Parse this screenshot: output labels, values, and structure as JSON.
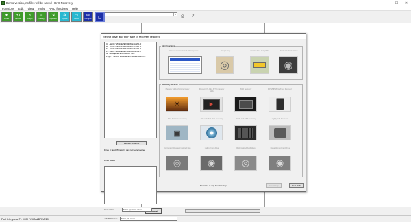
{
  "window": {
    "title": "Demo version, no files will be saved - DriK Recovery",
    "controls": {
      "minimize": "–",
      "maximize": "☐",
      "close": "✕"
    }
  },
  "menu": [
    "Functions",
    "Edit",
    "View",
    "Tools",
    "RAID functions",
    "Help"
  ],
  "toolbar": {
    "buttons": [
      {
        "label": "Wizard",
        "color": "#3f9b2a"
      },
      {
        "label": "Recover",
        "color": "#3f9b2a"
      },
      {
        "label": "Analyze",
        "color": "#3f9b2a"
      },
      {
        "label": "Catalog",
        "color": "#3f9b2a"
      },
      {
        "label": "Unpacked",
        "color": "#3f9b2a"
      },
      {
        "label": "Options",
        "color": "#2ab8d0"
      },
      {
        "label": "Drives",
        "color": "#2ab8d0"
      },
      {
        "label": "Configure",
        "color": "#1c2fa8"
      },
      {
        "label": "",
        "color": "#1c2fa8"
      }
    ],
    "select_arrow": "▾",
    "icons": [
      "printer-icon",
      "help-pointer-icon"
    ]
  },
  "bottom": {
    "cancel_label": "Cancel"
  },
  "statusbar": {
    "help_text": "For Help, press F1",
    "device_path": "\\\\.\\PHYSICALDRIVE19"
  },
  "dialog": {
    "title": "Select drive and then type of recovery required",
    "drives": [
      "C: - WDC      WD10EZEX-08WN4A0/01.0",
      "D: - WDC      WD10EZEX-08WN4A0/01.0",
      "E: - WDC      WD10EZEX-08WN4A0/01.0",
      "F: - WDC      WD10EZEX-08WN4A0/01.0",
      "G: - Image file and backup files",
      "Phys 1 - WDC    WD10EZEX-08WN4A0/01.0"
    ],
    "refresh_label": "Refresh drive list",
    "warning": "Drive C: and Physical 0 can not be recovered",
    "status_label": "Drive status",
    "user_label": "User name",
    "user_placeholder": "Enter operator name",
    "job_label": "Job Reference",
    "job_placeholder": "Enter job name",
    "main_functions_label": "Main functions",
    "main_functions": [
      "Recover Contents and other options",
      "Deep Lossy",
      "Create drive image file",
      "Make Duplicate Drive"
    ],
    "wizards_label": "Recovery wizards",
    "wizards": [
      "Memory Stick photo recovery",
      "Recover IN-DEL MTD memory Stick",
      "SSD recovery",
      "MP4/MP3/Pics/Files Recovery",
      "Mini DV video recovery",
      "CD and DVD data recovery",
      "RAID and NSF recovery",
      "Lighty and Recovers",
      "Corrupted drive and deleted files",
      "Failing hard drive",
      "Reformatted hard drive",
      "Repartitioned hard drive"
    ],
    "help_hint": "Press F1 at any time for Help",
    "next_label": "Next Step",
    "exit_label": "Exit DriK"
  }
}
